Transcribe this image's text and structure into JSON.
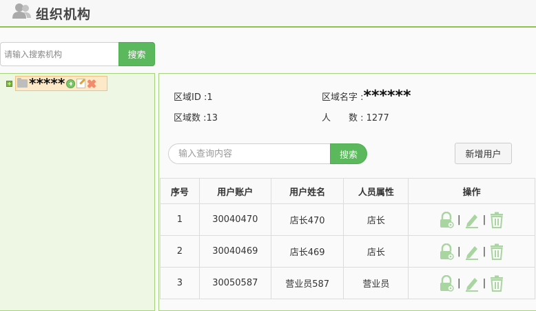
{
  "header": {
    "title": "组织机构",
    "icon": "users-icon"
  },
  "left_search": {
    "placeholder": "请输入搜索机构",
    "button_label": "搜索"
  },
  "tree": {
    "root_label": "*****",
    "icons": [
      "folder-icon",
      "add-node-icon",
      "edit-node-icon",
      "delete-node-icon"
    ]
  },
  "info": {
    "region_id_label": "区域ID :1",
    "region_name_label": "区域名字 :",
    "region_name_value": "******",
    "region_count_label": "区域数 :13",
    "people_label": "人　　数 : 1277"
  },
  "query": {
    "placeholder": "输入查询内容",
    "button_label": "搜索",
    "add_user_label": "新增用户"
  },
  "table": {
    "headers": [
      "序号",
      "用户账户",
      "用户姓名",
      "人员属性",
      "操作"
    ],
    "rows": [
      {
        "index": "1",
        "account": "30040470",
        "name": "店长470",
        "role": "店长"
      },
      {
        "index": "2",
        "account": "30040469",
        "name": "店长469",
        "role": "店长"
      },
      {
        "index": "3",
        "account": "30050587",
        "name": "营业员587",
        "role": "营业员"
      }
    ],
    "separator": "|",
    "op_icons": [
      "lock-settings-icon",
      "edit-icon",
      "trash-icon"
    ]
  },
  "colors": {
    "accent": "#5cb85c",
    "border_green": "#a5d37b",
    "tree_bg": "#eef6e4",
    "icon_green": "#a8d5a0"
  }
}
